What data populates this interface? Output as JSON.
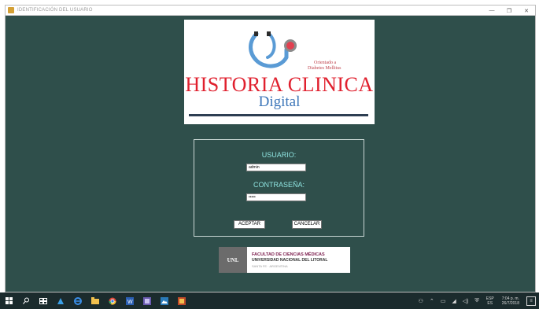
{
  "window": {
    "title": "IDENTIFICACIÓN DEL USUARIO",
    "minimize": "—",
    "maximize": "❐",
    "close": "✕"
  },
  "logo": {
    "title": "HISTORIA CLINICA",
    "subtitle": "Digital",
    "tagline_line1": "Orientado a",
    "tagline_line2": "Diabetes Mellitus"
  },
  "login": {
    "user_label": "USUARIO:",
    "user_value": "admin",
    "password_label": "CONTRASEÑA:",
    "password_value": "•••••",
    "accept_label": "ACEPTAR",
    "cancel_label": "CANCELAR"
  },
  "institution": {
    "logo_text": "UNL",
    "line1": "FACULTAD DE CIENCIAS MÉDICAS",
    "line2": "UNIVERSIDAD NACIONAL DEL LITORAL",
    "line3": "SANTA FE · ARGENTINA"
  },
  "taskbar": {
    "language_top": "ESP",
    "language_bottom": "ES",
    "time": "7:04 p. m.",
    "date": "26/7/2018",
    "icons": [
      "windows-start-icon",
      "search-icon",
      "task-view-icon",
      "store-icon",
      "edge-icon",
      "file-explorer-icon",
      "chrome-icon",
      "word-icon",
      "app-icon",
      "image-app-icon",
      "java-icon"
    ]
  }
}
